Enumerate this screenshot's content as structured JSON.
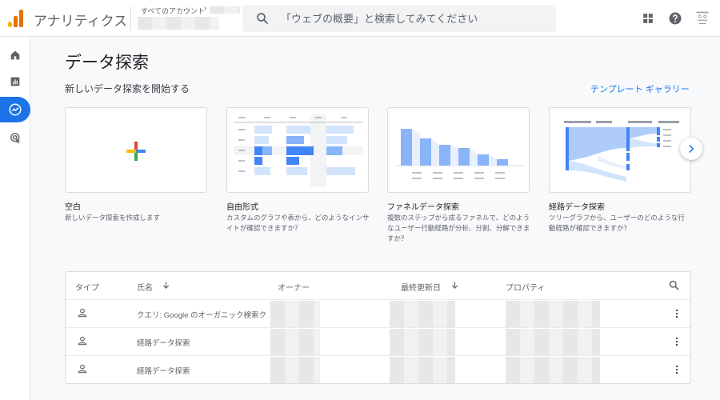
{
  "header": {
    "app_title": "アナリティクス",
    "account_crumb": "すべてのアカウント",
    "search_placeholder": "「ウェブの概要」と検索してみてください"
  },
  "icons": {
    "logo": "analytics-logo",
    "search": "search-icon",
    "apps": "apps-grid-icon",
    "help": "help-icon",
    "account": "account-icon"
  },
  "rail": {
    "items": [
      {
        "name": "home",
        "icon": "home-icon"
      },
      {
        "name": "reports",
        "icon": "bar-chart-icon"
      },
      {
        "name": "explore",
        "icon": "explore-icon",
        "active": true
      },
      {
        "name": "advertising",
        "icon": "advertising-icon"
      }
    ]
  },
  "main": {
    "page_title": "データ探索",
    "section_title": "新しいデータ探索を開始する",
    "gallery_link": "テンプレート ギャラリー",
    "cards": [
      {
        "title": "空白",
        "desc": "新しいデータ探索を作成します"
      },
      {
        "title": "自由形式",
        "desc": "カスタムのグラフや表から、どのようなインサイトが確認できますか？"
      },
      {
        "title": "ファネルデータ探索",
        "desc": "複数のステップから成るファネルで、どのようなユーザー行動経路が分析、分割、分解できますか？"
      },
      {
        "title": "経路データ探索",
        "desc": "ツリーグラフから、ユーザーのどのような行動経路が確認できますか？"
      }
    ]
  },
  "table": {
    "headers": {
      "type": "タイプ",
      "name": "氏名",
      "owner": "オーナー",
      "last_modified": "最終更新日",
      "property": "プロパティ"
    },
    "rows": [
      {
        "name": "クエリ: Google のオーガニック検索ク"
      },
      {
        "name": "経路データ探索"
      },
      {
        "name": "経路データ探索"
      }
    ]
  },
  "colors": {
    "accent": "#1a73e8",
    "chart_blue": "#8ab4f8",
    "chart_blue_dark": "#4285f4",
    "logo_orange": "#e37400",
    "logo_yellow": "#f9ab00"
  }
}
